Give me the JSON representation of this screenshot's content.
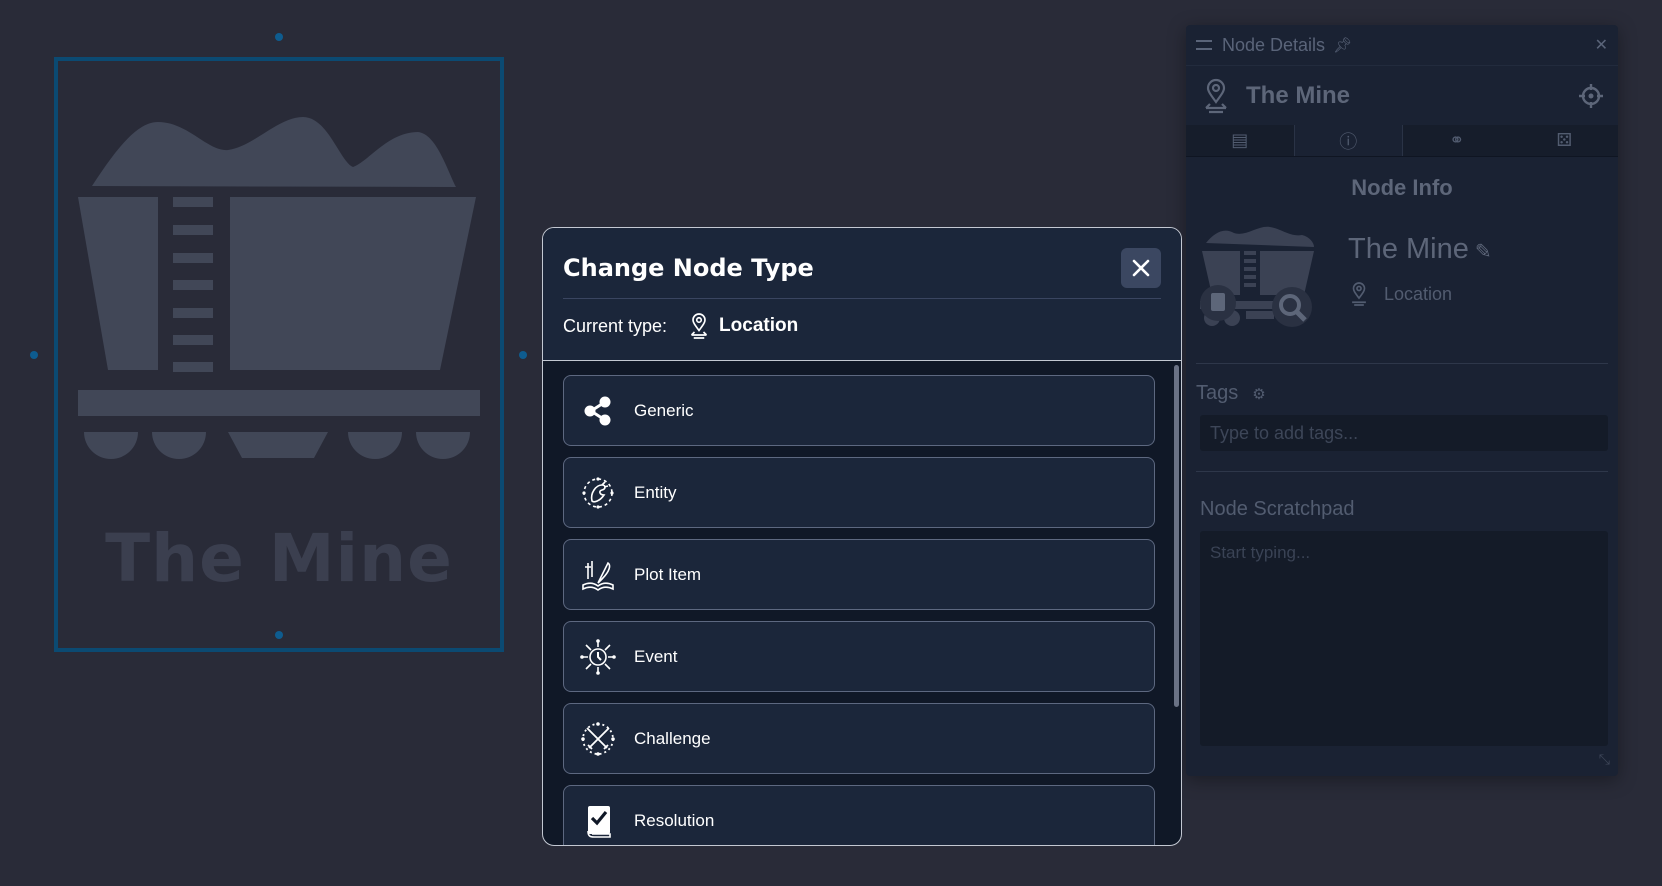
{
  "canvas": {
    "node_title": "The Mine"
  },
  "panel": {
    "header_title": "Node Details",
    "node_title": "The Mine",
    "tabs": [
      {
        "icon": "newspaper-icon"
      },
      {
        "icon": "info-icon"
      },
      {
        "icon": "link-icon"
      },
      {
        "icon": "dice-icon"
      }
    ],
    "section_title": "Node Info",
    "node_name": "The Mine",
    "node_type": "Location",
    "tags_label": "Tags",
    "tags_placeholder": "Type to add tags...",
    "scratchpad_label": "Node Scratchpad",
    "scratchpad_placeholder": "Start typing..."
  },
  "modal": {
    "title": "Change Node Type",
    "current_type_label": "Current type:",
    "current_type_value": "Location",
    "options": [
      {
        "label": "Generic",
        "icon": "share-icon"
      },
      {
        "label": "Entity",
        "icon": "dragon-icon"
      },
      {
        "label": "Plot Item",
        "icon": "quill-book-icon"
      },
      {
        "label": "Event",
        "icon": "clock-burst-icon"
      },
      {
        "label": "Challenge",
        "icon": "crossed-swords-icon"
      },
      {
        "label": "Resolution",
        "icon": "checked-book-icon"
      }
    ]
  }
}
